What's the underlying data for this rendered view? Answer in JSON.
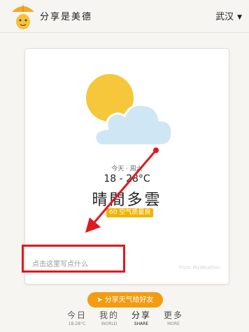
{
  "header": {
    "title": "分享是美德",
    "city": "武汉",
    "logo_icon": "umbrella-mascot-icon",
    "city_caret_icon": "caret-down-icon"
  },
  "card": {
    "weather_icon": "partly-cloudy-icon",
    "date_line": "今天 · 周六",
    "temperature": "18 - 28°C",
    "condition": "晴間多雲",
    "aqi": "60 空气质量良",
    "note_placeholder": "点击这里写点什么",
    "watermark": "From MyWeather"
  },
  "share_button": {
    "label": "分享天气给好友",
    "icon": "send-icon"
  },
  "tabs": [
    {
      "zh": "今日",
      "en": "18-28°C"
    },
    {
      "zh": "我的",
      "en": "WORLD"
    },
    {
      "zh": "分享",
      "en": "SHARE"
    },
    {
      "zh": "更多",
      "en": "MORE"
    }
  ],
  "colors": {
    "accent": "#f39c12",
    "annotation": "#e0181f",
    "sun": "#f6c73a",
    "cloud": "#cfe6f4"
  }
}
